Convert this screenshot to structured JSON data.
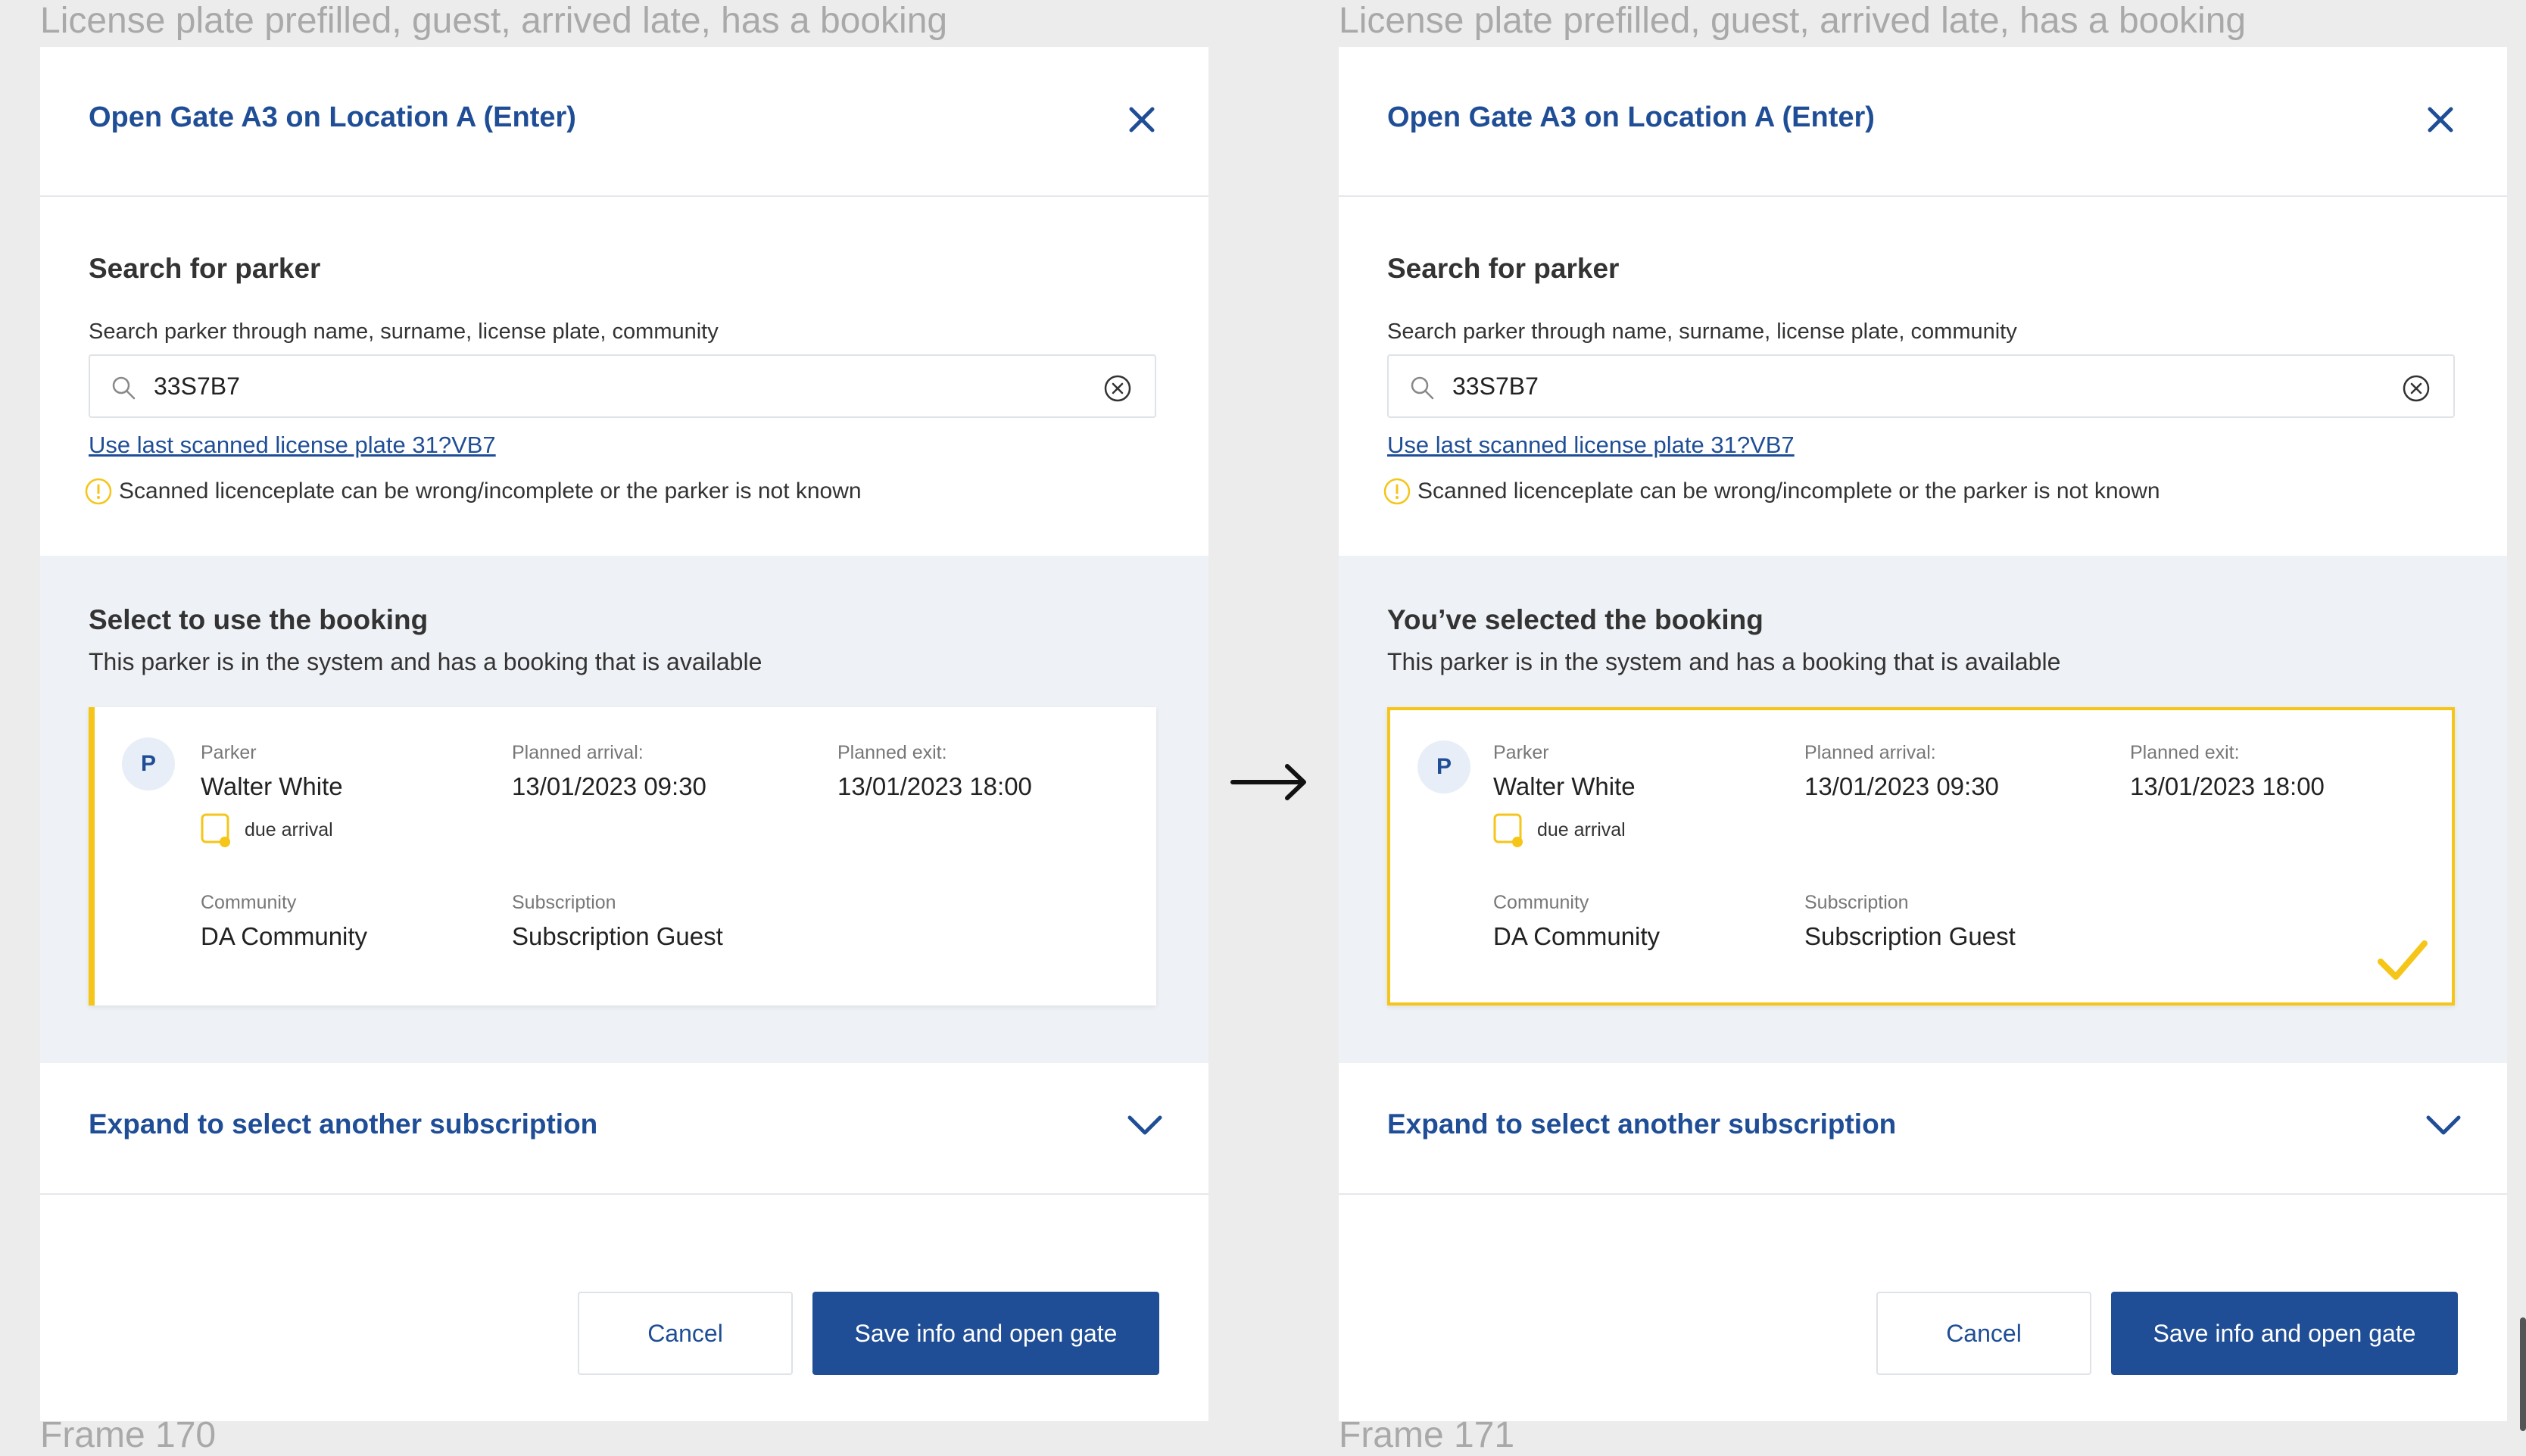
{
  "frames": [
    {
      "caption_top": "License plate prefilled, guest, arrived late, has a booking",
      "caption_bottom": "Frame 170",
      "title": "Open Gate A3 on Location A (Enter)",
      "search": {
        "heading": "Search for parker",
        "sublabel": "Search parker through name, surname, license plate, community",
        "value": "33S7B7",
        "scan_link": "Use last scanned license plate  31?VB7",
        "warning": "Scanned licenceplate can be wrong/incomplete or the parker is not known"
      },
      "booking": {
        "heading": "Select to use the booking",
        "sub": "This parker is in the system and has a booking that is available",
        "selected": false,
        "avatar": "P",
        "parker_label": "Parker",
        "parker_name": "Walter White",
        "status": "due arrival",
        "arrival_label": "Planned arrival:",
        "arrival_value": "13/01/2023 09:30",
        "exit_label": "Planned exit:",
        "exit_value": "13/01/2023 18:00",
        "community_label": "Community",
        "community_value": "DA Community",
        "subscription_label": "Subscription",
        "subscription_value": "Subscription Guest"
      },
      "expand_label": "Expand to select another subscription",
      "cancel_label": "Cancel",
      "save_label": "Save info and open gate"
    },
    {
      "caption_top": "License plate prefilled, guest, arrived late, has a booking",
      "caption_bottom": "Frame 171",
      "title": "Open Gate A3 on Location A (Enter)",
      "search": {
        "heading": "Search for parker",
        "sublabel": "Search parker through name, surname, license plate, community",
        "value": "33S7B7",
        "scan_link": "Use last scanned license plate  31?VB7",
        "warning": "Scanned licenceplate can be wrong/incomplete or the parker is not known"
      },
      "booking": {
        "heading": "You’ve selected the booking",
        "sub": "This parker is in the system and has a booking that is available",
        "selected": true,
        "avatar": "P",
        "parker_label": "Parker",
        "parker_name": "Walter White",
        "status": "due arrival",
        "arrival_label": "Planned arrival:",
        "arrival_value": "13/01/2023 09:30",
        "exit_label": "Planned exit:",
        "exit_value": "13/01/2023 18:00",
        "community_label": "Community",
        "community_value": "DA Community",
        "subscription_label": "Subscription",
        "subscription_value": "Subscription Guest"
      },
      "expand_label": "Expand to select another subscription",
      "cancel_label": "Cancel",
      "save_label": "Save info and open gate"
    }
  ],
  "colors": {
    "primary": "#1f4e96",
    "accent_yellow": "#f5c518",
    "section_bg": "#eef1f5"
  },
  "icons": [
    "close-icon",
    "search-icon",
    "clear-icon",
    "info-icon",
    "due-arrival-icon",
    "checkmark-icon",
    "chevron-down-icon",
    "arrow-right-icon"
  ]
}
